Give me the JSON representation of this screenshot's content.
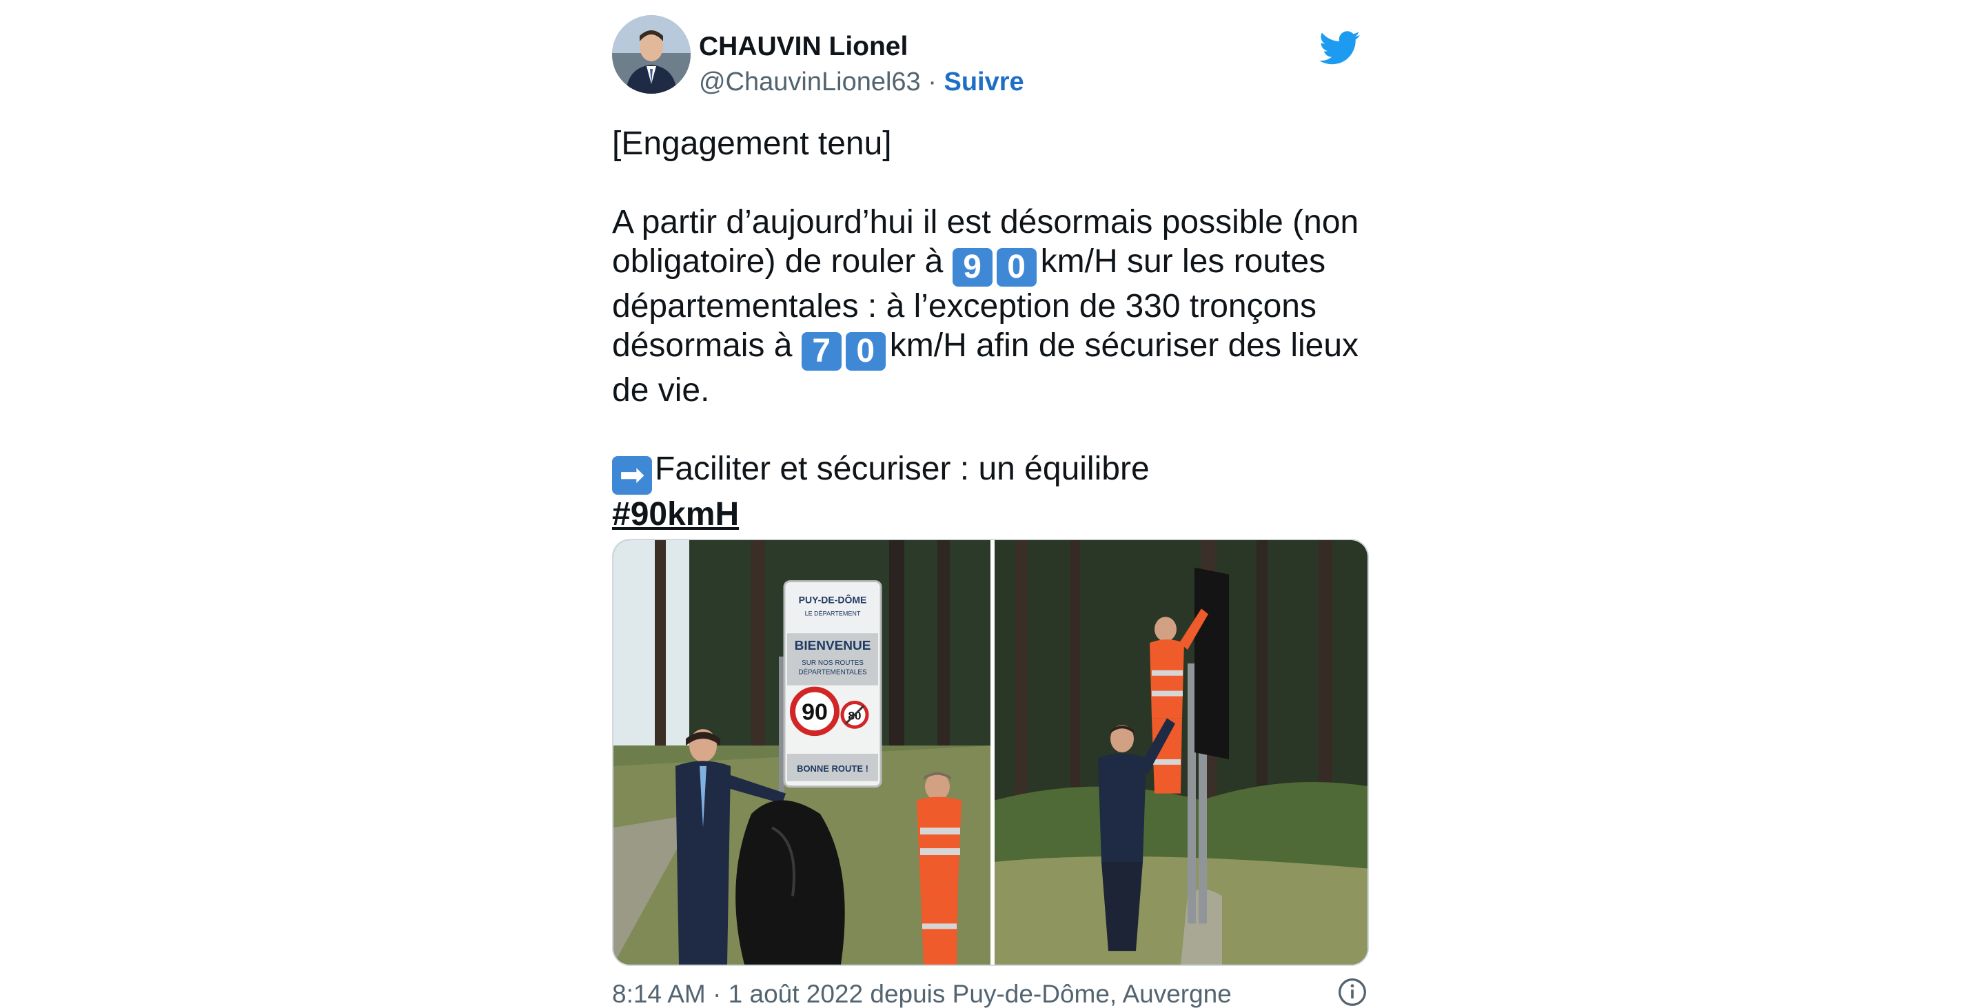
{
  "tweet": {
    "author_name": "CHAUVIN Lionel",
    "handle": "@ChauvinLionel63",
    "separator": " · ",
    "follow_label": "Suivre",
    "icons": {
      "platform": "twitter-bird-icon",
      "info": "info-icon"
    },
    "colors": {
      "accent": "#1d6ec6",
      "keycap": "#3f88d5",
      "bird": "#1d9bf0"
    },
    "body": {
      "line1": "[Engagement tenu]",
      "p2_a": "A partir d’aujourd’hui il est désormais possible (non obligatoire) de rouler à ",
      "speed_90": [
        "9",
        "0"
      ],
      "p2_b": "km/H sur les routes départementales : à l’exception de 330 tronçons désormais à ",
      "speed_70": [
        "7",
        "0"
      ],
      "p2_c": "km/H afin de sécuriser des lieux de vie.",
      "p3_emoji": "➡",
      "p3": "Faciliter et sécuriser : un équilibre",
      "hashtag": "#90kmH"
    },
    "media": {
      "sign": {
        "brand": "PUY-DE-DÔME",
        "brand_sub": "LE DÉPARTEMENT",
        "welcome": "BIENVENUE",
        "sub1": "SUR NOS ROUTES",
        "sub2": "DÉPARTEMENTALES",
        "limit_main": "90",
        "limit_secondary": "80",
        "farewell": "BONNE ROUTE !"
      }
    },
    "footer": "8:14 AM · 1 août 2022 depuis Puy-de-Dôme, Auvergne"
  }
}
